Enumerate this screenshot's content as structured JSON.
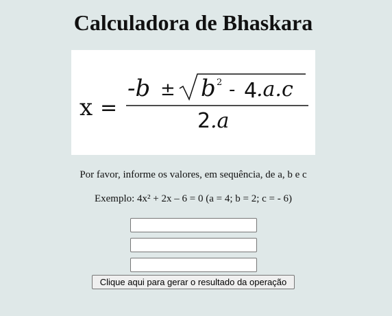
{
  "page": {
    "title": "Calculadora de Bhaskara"
  },
  "formula": {
    "lhs": "x",
    "equals": "=",
    "neg_b": "-b",
    "plus_minus": "±",
    "b_term": "b",
    "squared": "2",
    "minus": "-",
    "four": "4",
    "ac": ".a.c",
    "denominator_two": "2",
    "denominator_a": ".a"
  },
  "instructions": {
    "prompt": "Por favor, informe os valores, em sequência, de a, b e c",
    "example": "Exemplo: 4x² + 2x – 6 = 0 (a = 4; b = 2; c = - 6)"
  },
  "inputs": {
    "a": {
      "value": "",
      "placeholder": ""
    },
    "b": {
      "value": "",
      "placeholder": ""
    },
    "c": {
      "value": "",
      "placeholder": ""
    }
  },
  "actions": {
    "calculate_label": "Clique aqui para gerar o resultado da operação"
  }
}
